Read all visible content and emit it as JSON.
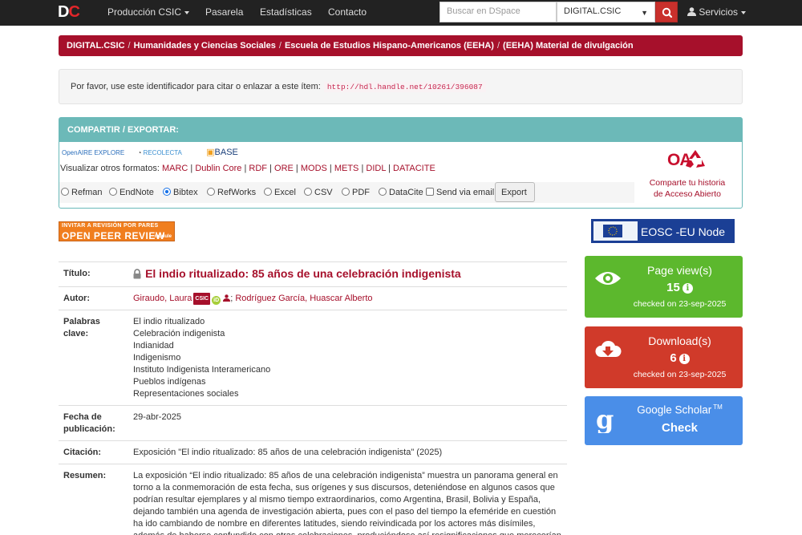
{
  "navbar": {
    "logo_d": "D",
    "logo_c": "C",
    "menu": [
      "Producción CSIC",
      "Pasarela",
      "Estadísticas",
      "Contacto"
    ],
    "search_placeholder": "Buscar en DSpace",
    "scope_value": "DIGITAL.CSIC",
    "user_label": "Servicios"
  },
  "breadcrumb": [
    "DIGITAL.CSIC",
    "Humanidades y Ciencias Sociales",
    "Escuela de Estudios Hispano-Americanos (EEHA)",
    "(EEHA) Material de divulgación"
  ],
  "cite": {
    "text": "Por favor, use este identificador para citar o enlazar a este ítem:",
    "handle": "http://hdl.handle.net/10261/396087"
  },
  "share": {
    "header": "COMPARTIR / EXPORTAR:",
    "logos": [
      "OpenAIRE EXPLORE",
      "RECOLECTA",
      "BASE"
    ],
    "formats_label": "Visualizar otros formatos:",
    "formats": [
      "MARC",
      "Dublin Core",
      "RDF",
      "ORE",
      "MODS",
      "METS",
      "DIDL",
      "DATACITE"
    ],
    "export_options": [
      "Refman",
      "EndNote",
      "Bibtex",
      "RefWorks",
      "Excel",
      "CSV",
      "PDF",
      "DataCite"
    ],
    "selected_option": "Bibtex",
    "send_email": "Send via email",
    "export_button": "Export",
    "oa_logo": "OA",
    "oa_line1": "Comparte tu historia",
    "oa_line2": "de Acceso Abierto"
  },
  "peer_review": {
    "line1": "INVITAR A REVISIÓN POR PARES",
    "line2": "OPEN PEER REVIEW",
    "line3": "module"
  },
  "item": {
    "title_label": "Título",
    "title": "El indio ritualizado: 85 años de una celebración indigenista",
    "author_label": "Autor",
    "author1": "Giraudo, Laura",
    "author1_badge": "CSIC",
    "author1_orcid": "iD",
    "author2": "Rodríguez García, Huascar Alberto",
    "keywords_label_1": "Palabras",
    "keywords_label_2": "clave",
    "keywords": [
      "El indio ritualizado",
      "Celebración indigenista",
      "Indianidad",
      "Indigenismo",
      "Instituto Indigenista Interamericano",
      "Pueblos indígenas",
      "Representaciones sociales"
    ],
    "date_label_1": "Fecha de",
    "date_label_2": "publicación",
    "date": "29-abr-2025",
    "citation_label": "Citación",
    "citation": "Exposición \"El indio ritualizado: 85 años de una celebración indigenista\" (2025)",
    "abstract_label": "Resumen",
    "abstract": "La exposición “El indio ritualizado: 85 años de una celebración indigenista” muestra un panorama general en torno a la conmemoración de esta fecha, sus orígenes y sus discursos, deteniéndose en algunos casos que podrían resultar ejemplares y al mismo tiempo extraordinarios, como Argentina, Brasil, Bolivia y España, dejando también una agenda de investigación abierta, pues con el paso del tiempo la efeméride en cuestión ha ido cambiando de nombre en diferentes latitudes, siendo reivindicada por los actores más disímiles, además de haberse confundido con otras celebraciones, produciéndose así resignificaciones que merecerían nuevas pesquisas"
  },
  "sidebar": {
    "eosc": "EOSC -EU Node",
    "views_label": "Page view(s)",
    "views_count": "15",
    "views_date": "checked on 23-sep-2025",
    "downloads_label": "Download(s)",
    "downloads_count": "6",
    "downloads_date": "checked on 23-sep-2025",
    "scholar_label": "Google Scholar",
    "scholar_tm": "TM",
    "scholar_check": "Check"
  },
  "colors": {
    "brand": "#a6102b",
    "navbar": "#222222",
    "share_header": "#6cb9b8",
    "views": "#5cb82d",
    "downloads": "#d03a2a",
    "scholar": "#4a8ee8"
  }
}
